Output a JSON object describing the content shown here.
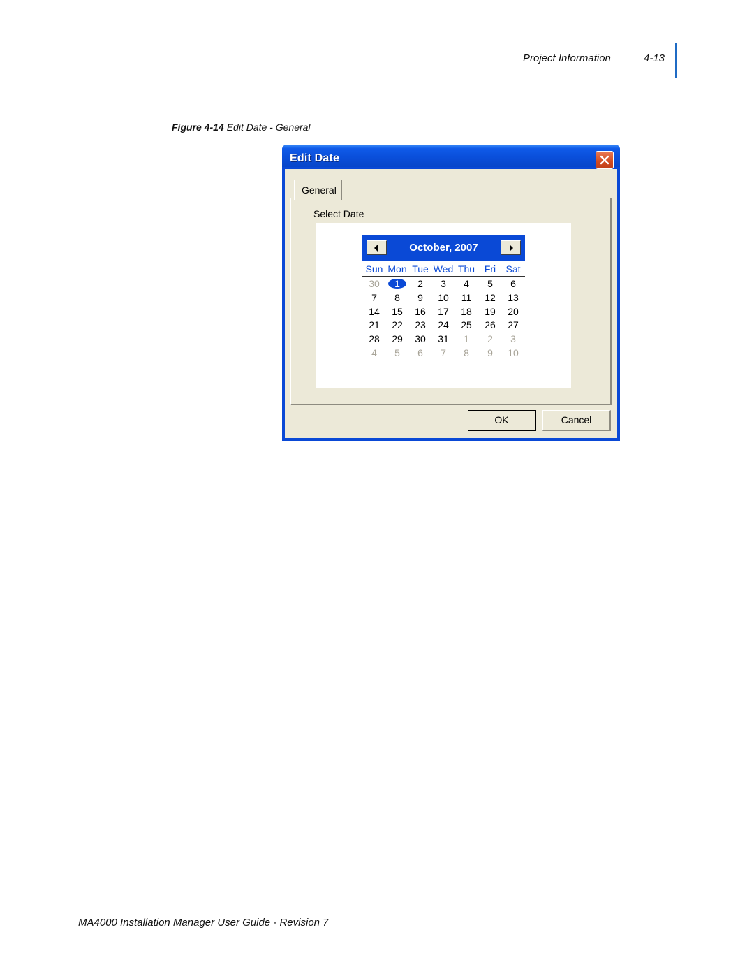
{
  "page_header": {
    "section_title": "Project Information",
    "page_number": "4-13",
    "accent_color": "#1f6bc4"
  },
  "figure": {
    "label": "Figure 4-14",
    "caption": "Edit Date - General"
  },
  "dialog": {
    "title": "Edit Date",
    "close_icon": "close-x-icon",
    "tabs": [
      {
        "label": "General",
        "active": true
      }
    ],
    "select_label": "Select Date",
    "calendar": {
      "month_label": "October, 2007",
      "prev_icon": "left-triangle-icon",
      "next_icon": "right-triangle-icon",
      "weekdays": [
        "Sun",
        "Mon",
        "Tue",
        "Wed",
        "Thu",
        "Fri",
        "Sat"
      ],
      "selected_day": "1",
      "weeks": [
        [
          {
            "d": "30",
            "o": true
          },
          {
            "d": "1",
            "o": false,
            "sel": true
          },
          {
            "d": "2",
            "o": false
          },
          {
            "d": "3",
            "o": false
          },
          {
            "d": "4",
            "o": false
          },
          {
            "d": "5",
            "o": false
          },
          {
            "d": "6",
            "o": false
          }
        ],
        [
          {
            "d": "7",
            "o": false
          },
          {
            "d": "8",
            "o": false
          },
          {
            "d": "9",
            "o": false
          },
          {
            "d": "10",
            "o": false
          },
          {
            "d": "11",
            "o": false
          },
          {
            "d": "12",
            "o": false
          },
          {
            "d": "13",
            "o": false
          }
        ],
        [
          {
            "d": "14",
            "o": false
          },
          {
            "d": "15",
            "o": false
          },
          {
            "d": "16",
            "o": false
          },
          {
            "d": "17",
            "o": false
          },
          {
            "d": "18",
            "o": false
          },
          {
            "d": "19",
            "o": false
          },
          {
            "d": "20",
            "o": false
          }
        ],
        [
          {
            "d": "21",
            "o": false
          },
          {
            "d": "22",
            "o": false
          },
          {
            "d": "23",
            "o": false
          },
          {
            "d": "24",
            "o": false
          },
          {
            "d": "25",
            "o": false
          },
          {
            "d": "26",
            "o": false
          },
          {
            "d": "27",
            "o": false
          }
        ],
        [
          {
            "d": "28",
            "o": false
          },
          {
            "d": "29",
            "o": false
          },
          {
            "d": "30",
            "o": false
          },
          {
            "d": "31",
            "o": false
          },
          {
            "d": "1",
            "o": true
          },
          {
            "d": "2",
            "o": true
          },
          {
            "d": "3",
            "o": true
          }
        ],
        [
          {
            "d": "4",
            "o": true
          },
          {
            "d": "5",
            "o": true
          },
          {
            "d": "6",
            "o": true
          },
          {
            "d": "7",
            "o": true
          },
          {
            "d": "8",
            "o": true
          },
          {
            "d": "9",
            "o": true
          },
          {
            "d": "10",
            "o": true
          }
        ]
      ],
      "header_color": "#0a49d6"
    },
    "buttons": {
      "ok": "OK",
      "cancel": "Cancel"
    }
  },
  "page_footer": {
    "text": "MA4000 Installation Manager User Guide - Revision 7"
  }
}
